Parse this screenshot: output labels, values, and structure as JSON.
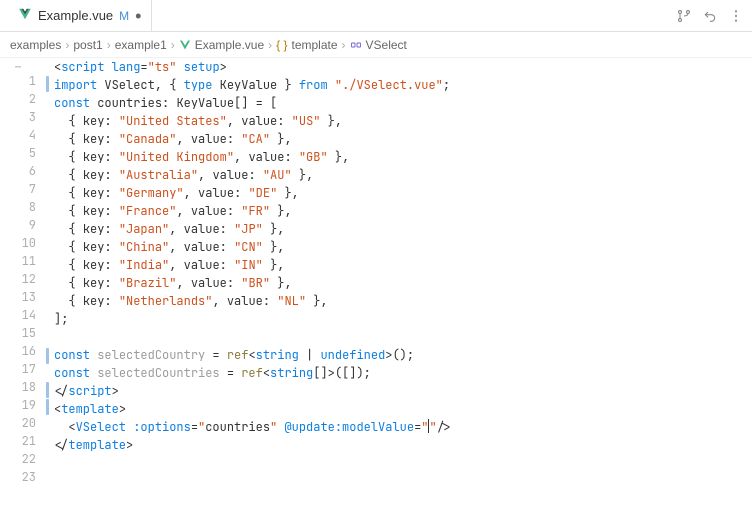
{
  "tab": {
    "filename": "Example.vue",
    "modified_marker": "M"
  },
  "breadcrumb": {
    "items": [
      {
        "label": "examples",
        "icon": ""
      },
      {
        "label": "post1",
        "icon": ""
      },
      {
        "label": "example1",
        "icon": ""
      },
      {
        "label": "Example.vue",
        "icon": "vue"
      },
      {
        "label": "template",
        "icon": "braces"
      },
      {
        "label": "VSelect",
        "icon": "component"
      }
    ]
  },
  "code": {
    "lines": [
      {
        "n": 1,
        "rail": "",
        "tokens": [
          {
            "t": "<",
            "c": "t-punc"
          },
          {
            "t": "script",
            "c": "t-tag"
          },
          {
            "t": " ",
            "c": ""
          },
          {
            "t": "lang",
            "c": "t-attr"
          },
          {
            "t": "=",
            "c": "t-punc"
          },
          {
            "t": "\"ts\"",
            "c": "t-str"
          },
          {
            "t": " ",
            "c": ""
          },
          {
            "t": "setup",
            "c": "t-attr"
          },
          {
            "t": ">",
            "c": "t-punc"
          }
        ]
      },
      {
        "n": 2,
        "rail": "blue",
        "tokens": [
          {
            "t": "import",
            "c": "t-kw"
          },
          {
            "t": " ",
            "c": ""
          },
          {
            "t": "VSelect",
            "c": "t-ident"
          },
          {
            "t": ", { ",
            "c": "t-punc"
          },
          {
            "t": "type",
            "c": "t-kw"
          },
          {
            "t": " ",
            "c": ""
          },
          {
            "t": "KeyValue",
            "c": "t-ident"
          },
          {
            "t": " } ",
            "c": "t-punc"
          },
          {
            "t": "from",
            "c": "t-kw"
          },
          {
            "t": " ",
            "c": ""
          },
          {
            "t": "\"./VSelect.vue\"",
            "c": "t-str"
          },
          {
            "t": ";",
            "c": "t-punc"
          }
        ]
      },
      {
        "n": 3,
        "rail": "",
        "tokens": [
          {
            "t": "const",
            "c": "t-kw"
          },
          {
            "t": " ",
            "c": ""
          },
          {
            "t": "countries",
            "c": "t-ident"
          },
          {
            "t": ": ",
            "c": "t-punc"
          },
          {
            "t": "KeyValue",
            "c": "t-ident"
          },
          {
            "t": "[] = [",
            "c": "t-punc"
          }
        ]
      },
      {
        "n": 4,
        "rail": "",
        "tokens": [
          {
            "t": "  { ",
            "c": "t-punc"
          },
          {
            "t": "key",
            "c": "t-ident"
          },
          {
            "t": ": ",
            "c": "t-punc"
          },
          {
            "t": "\"United States\"",
            "c": "t-str"
          },
          {
            "t": ", ",
            "c": "t-punc"
          },
          {
            "t": "value",
            "c": "t-ident"
          },
          {
            "t": ": ",
            "c": "t-punc"
          },
          {
            "t": "\"US\"",
            "c": "t-str"
          },
          {
            "t": " },",
            "c": "t-punc"
          }
        ]
      },
      {
        "n": 5,
        "rail": "",
        "tokens": [
          {
            "t": "  { ",
            "c": "t-punc"
          },
          {
            "t": "key",
            "c": "t-ident"
          },
          {
            "t": ": ",
            "c": "t-punc"
          },
          {
            "t": "\"Canada\"",
            "c": "t-str"
          },
          {
            "t": ", ",
            "c": "t-punc"
          },
          {
            "t": "value",
            "c": "t-ident"
          },
          {
            "t": ": ",
            "c": "t-punc"
          },
          {
            "t": "\"CA\"",
            "c": "t-str"
          },
          {
            "t": " },",
            "c": "t-punc"
          }
        ]
      },
      {
        "n": 6,
        "rail": "",
        "tokens": [
          {
            "t": "  { ",
            "c": "t-punc"
          },
          {
            "t": "key",
            "c": "t-ident"
          },
          {
            "t": ": ",
            "c": "t-punc"
          },
          {
            "t": "\"United Kingdom\"",
            "c": "t-str"
          },
          {
            "t": ", ",
            "c": "t-punc"
          },
          {
            "t": "value",
            "c": "t-ident"
          },
          {
            "t": ": ",
            "c": "t-punc"
          },
          {
            "t": "\"GB\"",
            "c": "t-str"
          },
          {
            "t": " },",
            "c": "t-punc"
          }
        ]
      },
      {
        "n": 7,
        "rail": "",
        "tokens": [
          {
            "t": "  { ",
            "c": "t-punc"
          },
          {
            "t": "key",
            "c": "t-ident"
          },
          {
            "t": ": ",
            "c": "t-punc"
          },
          {
            "t": "\"Australia\"",
            "c": "t-str"
          },
          {
            "t": ", ",
            "c": "t-punc"
          },
          {
            "t": "value",
            "c": "t-ident"
          },
          {
            "t": ": ",
            "c": "t-punc"
          },
          {
            "t": "\"AU\"",
            "c": "t-str"
          },
          {
            "t": " },",
            "c": "t-punc"
          }
        ]
      },
      {
        "n": 8,
        "rail": "",
        "tokens": [
          {
            "t": "  { ",
            "c": "t-punc"
          },
          {
            "t": "key",
            "c": "t-ident"
          },
          {
            "t": ": ",
            "c": "t-punc"
          },
          {
            "t": "\"Germany\"",
            "c": "t-str"
          },
          {
            "t": ", ",
            "c": "t-punc"
          },
          {
            "t": "value",
            "c": "t-ident"
          },
          {
            "t": ": ",
            "c": "t-punc"
          },
          {
            "t": "\"DE\"",
            "c": "t-str"
          },
          {
            "t": " },",
            "c": "t-punc"
          }
        ]
      },
      {
        "n": 9,
        "rail": "",
        "tokens": [
          {
            "t": "  { ",
            "c": "t-punc"
          },
          {
            "t": "key",
            "c": "t-ident"
          },
          {
            "t": ": ",
            "c": "t-punc"
          },
          {
            "t": "\"France\"",
            "c": "t-str"
          },
          {
            "t": ", ",
            "c": "t-punc"
          },
          {
            "t": "value",
            "c": "t-ident"
          },
          {
            "t": ": ",
            "c": "t-punc"
          },
          {
            "t": "\"FR\"",
            "c": "t-str"
          },
          {
            "t": " },",
            "c": "t-punc"
          }
        ]
      },
      {
        "n": 10,
        "rail": "",
        "tokens": [
          {
            "t": "  { ",
            "c": "t-punc"
          },
          {
            "t": "key",
            "c": "t-ident"
          },
          {
            "t": ": ",
            "c": "t-punc"
          },
          {
            "t": "\"Japan\"",
            "c": "t-str"
          },
          {
            "t": ", ",
            "c": "t-punc"
          },
          {
            "t": "value",
            "c": "t-ident"
          },
          {
            "t": ": ",
            "c": "t-punc"
          },
          {
            "t": "\"JP\"",
            "c": "t-str"
          },
          {
            "t": " },",
            "c": "t-punc"
          }
        ]
      },
      {
        "n": 11,
        "rail": "",
        "tokens": [
          {
            "t": "  { ",
            "c": "t-punc"
          },
          {
            "t": "key",
            "c": "t-ident"
          },
          {
            "t": ": ",
            "c": "t-punc"
          },
          {
            "t": "\"China\"",
            "c": "t-str"
          },
          {
            "t": ", ",
            "c": "t-punc"
          },
          {
            "t": "value",
            "c": "t-ident"
          },
          {
            "t": ": ",
            "c": "t-punc"
          },
          {
            "t": "\"CN\"",
            "c": "t-str"
          },
          {
            "t": " },",
            "c": "t-punc"
          }
        ]
      },
      {
        "n": 12,
        "rail": "",
        "tokens": [
          {
            "t": "  { ",
            "c": "t-punc"
          },
          {
            "t": "key",
            "c": "t-ident"
          },
          {
            "t": ": ",
            "c": "t-punc"
          },
          {
            "t": "\"India\"",
            "c": "t-str"
          },
          {
            "t": ", ",
            "c": "t-punc"
          },
          {
            "t": "value",
            "c": "t-ident"
          },
          {
            "t": ": ",
            "c": "t-punc"
          },
          {
            "t": "\"IN\"",
            "c": "t-str"
          },
          {
            "t": " },",
            "c": "t-punc"
          }
        ]
      },
      {
        "n": 13,
        "rail": "",
        "tokens": [
          {
            "t": "  { ",
            "c": "t-punc"
          },
          {
            "t": "key",
            "c": "t-ident"
          },
          {
            "t": ": ",
            "c": "t-punc"
          },
          {
            "t": "\"Brazil\"",
            "c": "t-str"
          },
          {
            "t": ", ",
            "c": "t-punc"
          },
          {
            "t": "value",
            "c": "t-ident"
          },
          {
            "t": ": ",
            "c": "t-punc"
          },
          {
            "t": "\"BR\"",
            "c": "t-str"
          },
          {
            "t": " },",
            "c": "t-punc"
          }
        ]
      },
      {
        "n": 14,
        "rail": "",
        "tokens": [
          {
            "t": "  { ",
            "c": "t-punc"
          },
          {
            "t": "key",
            "c": "t-ident"
          },
          {
            "t": ": ",
            "c": "t-punc"
          },
          {
            "t": "\"Netherlands\"",
            "c": "t-str"
          },
          {
            "t": ", ",
            "c": "t-punc"
          },
          {
            "t": "value",
            "c": "t-ident"
          },
          {
            "t": ": ",
            "c": "t-punc"
          },
          {
            "t": "\"NL\"",
            "c": "t-str"
          },
          {
            "t": " },",
            "c": "t-punc"
          }
        ]
      },
      {
        "n": 15,
        "rail": "",
        "tokens": [
          {
            "t": "];",
            "c": "t-punc"
          }
        ]
      },
      {
        "n": 16,
        "rail": "",
        "tokens": []
      },
      {
        "n": 17,
        "rail": "",
        "tokens": [
          {
            "t": "const",
            "c": "t-kw"
          },
          {
            "t": " ",
            "c": ""
          },
          {
            "t": "selectedCountry",
            "c": "t-gray"
          },
          {
            "t": " = ",
            "c": "t-punc"
          },
          {
            "t": "ref",
            "c": "t-var"
          },
          {
            "t": "<",
            "c": "t-punc"
          },
          {
            "t": "string",
            "c": "t-kw"
          },
          {
            "t": " | ",
            "c": "t-punc"
          },
          {
            "t": "undefined",
            "c": "t-kw"
          },
          {
            "t": ">();",
            "c": "t-punc"
          }
        ]
      },
      {
        "n": 18,
        "rail": "blue",
        "tokens": [
          {
            "t": "const",
            "c": "t-kw"
          },
          {
            "t": " ",
            "c": ""
          },
          {
            "t": "selectedCountries",
            "c": "t-gray"
          },
          {
            "t": " = ",
            "c": "t-punc"
          },
          {
            "t": "ref",
            "c": "t-var"
          },
          {
            "t": "<",
            "c": "t-punc"
          },
          {
            "t": "string",
            "c": "t-kw"
          },
          {
            "t": "[]>([]);",
            "c": "t-punc"
          }
        ]
      },
      {
        "n": 19,
        "rail": "",
        "tokens": [
          {
            "t": "</",
            "c": "t-punc"
          },
          {
            "t": "script",
            "c": "t-tag"
          },
          {
            "t": ">",
            "c": "t-punc"
          }
        ]
      },
      {
        "n": 20,
        "rail": "blue",
        "tokens": [
          {
            "t": "<",
            "c": "t-punc"
          },
          {
            "t": "template",
            "c": "t-tag"
          },
          {
            "t": ">",
            "c": "t-punc"
          }
        ]
      },
      {
        "n": 21,
        "rail": "blue",
        "cursor": true,
        "tokens": [
          {
            "t": "  <",
            "c": "t-punc"
          },
          {
            "t": "VSelect",
            "c": "t-tag"
          },
          {
            "t": " ",
            "c": ""
          },
          {
            "t": ":options",
            "c": "t-attr"
          },
          {
            "t": "=",
            "c": "t-punc"
          },
          {
            "t": "\"",
            "c": "t-str"
          },
          {
            "t": "countries",
            "c": "t-ident"
          },
          {
            "t": "\"",
            "c": "t-str"
          },
          {
            "t": " ",
            "c": ""
          },
          {
            "t": "@update:modelValue",
            "c": "t-attr"
          },
          {
            "t": "=",
            "c": "t-punc"
          },
          {
            "t": "\"",
            "c": "t-str"
          },
          {
            "t": "",
            "c": "t-str",
            "caret": true
          },
          {
            "t": "\"",
            "c": "t-str"
          },
          {
            "t": "/>",
            "c": "t-punc"
          }
        ]
      },
      {
        "n": 22,
        "rail": "",
        "tokens": [
          {
            "t": "</",
            "c": "t-punc"
          },
          {
            "t": "template",
            "c": "t-tag"
          },
          {
            "t": ">",
            "c": "t-punc"
          }
        ]
      },
      {
        "n": 23,
        "rail": "",
        "tokens": []
      }
    ]
  },
  "rail_colors": {
    "blue": "#9fc2e8"
  }
}
